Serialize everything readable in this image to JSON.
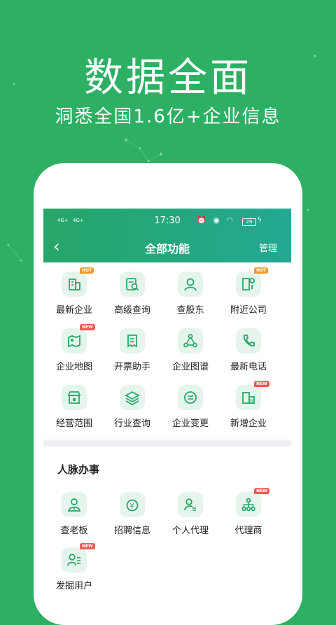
{
  "hero": {
    "title": "数据全面",
    "subtitle": "洞悉全国1.6亿+企业信息"
  },
  "status_bar": {
    "signal1": "4G+",
    "signal2": "4G+",
    "time": "17:30",
    "battery": "29"
  },
  "nav": {
    "back_glyph": "‹",
    "title": "全部功能",
    "manage_label": "管理"
  },
  "colors": {
    "brand": "#2eb064",
    "badge_hot": "#f39a2b",
    "badge_new": "#ee5a55"
  },
  "features": [
    {
      "label": "最新企业",
      "icon": "building-icon",
      "badge": "HOT"
    },
    {
      "label": "高级查询",
      "icon": "search-doc-icon",
      "badge": ""
    },
    {
      "label": "查股东",
      "icon": "person-icon",
      "badge": ""
    },
    {
      "label": "附近公司",
      "icon": "location-building-icon",
      "badge": "HOT"
    },
    {
      "label": "企业地图",
      "icon": "map-icon",
      "badge": "NEW"
    },
    {
      "label": "开票助手",
      "icon": "receipt-icon",
      "badge": ""
    },
    {
      "label": "企业图谱",
      "icon": "graph-icon",
      "badge": ""
    },
    {
      "label": "最新电话",
      "icon": "phone-icon",
      "badge": ""
    },
    {
      "label": "经营范围",
      "icon": "store-icon",
      "badge": ""
    },
    {
      "label": "行业查询",
      "icon": "layers-icon",
      "badge": ""
    },
    {
      "label": "企业变更",
      "icon": "swap-icon",
      "badge": ""
    },
    {
      "label": "新增企业",
      "icon": "new-building-icon",
      "badge": "NEW"
    }
  ],
  "section": {
    "title": "人脉办事"
  },
  "contacts": [
    {
      "label": "查老板",
      "icon": "boss-icon",
      "badge": ""
    },
    {
      "label": "招聘信息",
      "icon": "money-bag-icon",
      "badge": ""
    },
    {
      "label": "个人代理",
      "icon": "agent-icon",
      "badge": ""
    },
    {
      "label": "代理商",
      "icon": "org-chart-icon",
      "badge": "NEW"
    },
    {
      "label": "发掘用户",
      "icon": "user-list-icon",
      "badge": "NEW"
    }
  ]
}
